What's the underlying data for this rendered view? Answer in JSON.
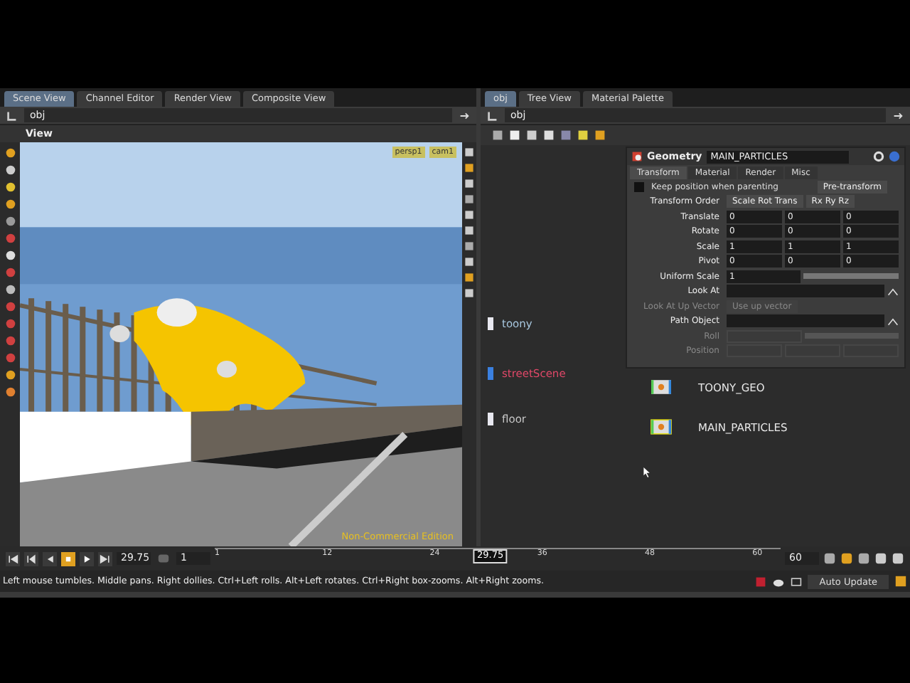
{
  "scene_pane": {
    "tabs": [
      {
        "label": "Scene View",
        "selected": true
      },
      {
        "label": "Channel Editor",
        "selected": false
      },
      {
        "label": "Render View",
        "selected": false
      },
      {
        "label": "Composite View",
        "selected": false
      }
    ],
    "path": "obj",
    "view_title": "View",
    "camera_menus": [
      "persp1",
      "cam1"
    ],
    "edition_label": "Non-Commercial Edition"
  },
  "network_pane": {
    "tabs": [
      {
        "label": "obj",
        "selected": true
      },
      {
        "label": "Tree View",
        "selected": false
      },
      {
        "label": "Material Palette",
        "selected": false
      }
    ],
    "path": "obj",
    "nodes": [
      {
        "label": "toony",
        "kind": "subnet",
        "color": "#a8c8e0",
        "selected": false
      },
      {
        "label": "streetScene",
        "kind": "subnet",
        "color": "#e04868",
        "selected": false
      },
      {
        "label": "floor",
        "kind": "subnet",
        "color": "#c8c8c8",
        "selected": false
      },
      {
        "label": "TOONY_GEO",
        "kind": "geometry",
        "color": "#e8e8e8",
        "selected": false
      },
      {
        "label": "MAIN_PARTICLES",
        "kind": "geometry",
        "color": "#e8e8e8",
        "selected": true
      }
    ],
    "parameters": {
      "type": "Geometry",
      "name": "MAIN_PARTICLES",
      "tabs": [
        {
          "label": "Transform",
          "selected": true
        },
        {
          "label": "Material",
          "selected": false
        },
        {
          "label": "Render",
          "selected": false
        },
        {
          "label": "Misc",
          "selected": false
        }
      ],
      "rows": [
        {
          "kind": "checkbox",
          "label": "Keep position when parenting",
          "checked": false,
          "menus": [
            "Pre-transform"
          ],
          "disabled": false
        },
        {
          "kind": "menus",
          "label": "Transform Order",
          "menus": [
            "Scale Rot Trans",
            "Rx Ry Rz"
          ],
          "disabled": false
        },
        {
          "kind": "vector",
          "label": "Translate",
          "values": [
            "0",
            "0",
            "0"
          ],
          "disabled": false
        },
        {
          "kind": "vector",
          "label": "Rotate",
          "values": [
            "0",
            "0",
            "0"
          ],
          "disabled": false
        },
        {
          "kind": "vector",
          "label": "Scale",
          "values": [
            "1",
            "1",
            "1"
          ],
          "disabled": false
        },
        {
          "kind": "vector",
          "label": "Pivot",
          "values": [
            "0",
            "0",
            "0"
          ],
          "disabled": false
        },
        {
          "kind": "slider",
          "label": "Uniform Scale",
          "value": "1",
          "level": 1,
          "disabled": false
        },
        {
          "kind": "path",
          "label": "Look At",
          "disabled": false
        },
        {
          "kind": "menus",
          "label": "Look At Up Vector",
          "menus": [
            "Use up vector"
          ],
          "disabled": true
        },
        {
          "kind": "path",
          "label": "Path Object",
          "disabled": false
        },
        {
          "kind": "slider",
          "label": "Roll",
          "disabled": true
        },
        {
          "kind": "vector",
          "label": "Position",
          "disabled": true
        }
      ]
    }
  },
  "timeline": {
    "transport": [
      {
        "kind": "first",
        "active": false
      },
      {
        "kind": "step_back",
        "active": false
      },
      {
        "kind": "reverse",
        "active": false
      },
      {
        "kind": "stop",
        "active": true
      },
      {
        "kind": "play",
        "active": false
      },
      {
        "kind": "last",
        "active": false
      }
    ],
    "frame": "29.75",
    "step": "1",
    "ticks": [
      "1",
      "12",
      "24",
      "36",
      "48",
      "60"
    ],
    "playhead": "29.75",
    "level": 0.487,
    "end": "60"
  },
  "status_bar": {
    "message": "Left mouse tumbles. Middle pans. Right dollies. Ctrl+Left rolls. Alt+Left rotates. Ctrl+Right box-zooms. Alt+Right zooms.",
    "update_mode": "Auto Update"
  }
}
